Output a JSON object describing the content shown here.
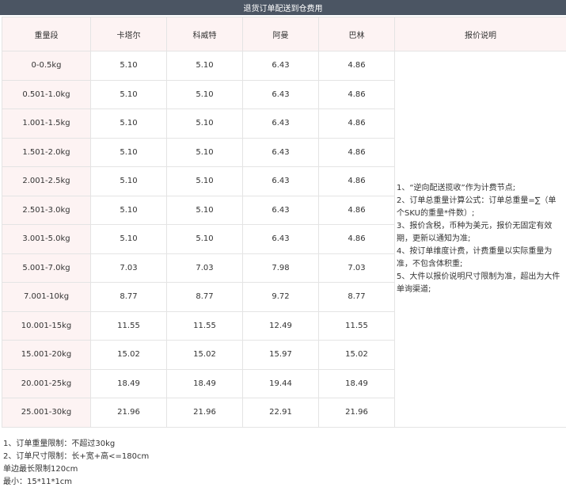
{
  "page_title": "退货订单配送到仓费用",
  "table": {
    "headers": [
      "重量段",
      "卡塔尔",
      "科威特",
      "阿曼",
      "巴林",
      "报价说明"
    ],
    "rows": [
      [
        "0-0.5kg",
        "5.10",
        "5.10",
        "6.43",
        "4.86"
      ],
      [
        "0.501-1.0kg",
        "5.10",
        "5.10",
        "6.43",
        "4.86"
      ],
      [
        "1.001-1.5kg",
        "5.10",
        "5.10",
        "6.43",
        "4.86"
      ],
      [
        "1.501-2.0kg",
        "5.10",
        "5.10",
        "6.43",
        "4.86"
      ],
      [
        "2.001-2.5kg",
        "5.10",
        "5.10",
        "6.43",
        "4.86"
      ],
      [
        "2.501-3.0kg",
        "5.10",
        "5.10",
        "6.43",
        "4.86"
      ],
      [
        "3.001-5.0kg",
        "5.10",
        "5.10",
        "6.43",
        "4.86"
      ],
      [
        "5.001-7.0kg",
        "7.03",
        "7.03",
        "7.98",
        "7.03"
      ],
      [
        "7.001-10kg",
        "8.77",
        "8.77",
        "9.72",
        "8.77"
      ],
      [
        "10.001-15kg",
        "11.55",
        "11.55",
        "12.49",
        "11.55"
      ],
      [
        "15.001-20kg",
        "15.02",
        "15.02",
        "15.97",
        "15.02"
      ],
      [
        "20.001-25kg",
        "18.49",
        "18.49",
        "19.44",
        "18.49"
      ],
      [
        "25.001-30kg",
        "21.96",
        "21.96",
        "22.91",
        "21.96"
      ]
    ],
    "notes": [
      "1、“逆向配送揽收”作为计费节点;",
      "2、订单总重量计算公式：订单总重量=∑（单个SKU的重量*件数）;",
      "3、报价含税，币种为美元，报价无固定有效期，更新以通知为准;",
      "4、按订单维度计费，计费重量以实际重量为准，不包含体积重;",
      "5、大件以报价说明尺寸限制为准，超出为大件单询渠道;"
    ]
  },
  "footer": [
    "1、订单重量限制：不超过30kg",
    "2、订单尺寸限制：长+宽+高<=180cm",
    "单边最长限制120cm",
    "最小：15*11*1cm"
  ],
  "colors": {
    "title_bar": "#4b5563",
    "header_bg": "#fdf3f3",
    "border": "#e4e4e4"
  }
}
